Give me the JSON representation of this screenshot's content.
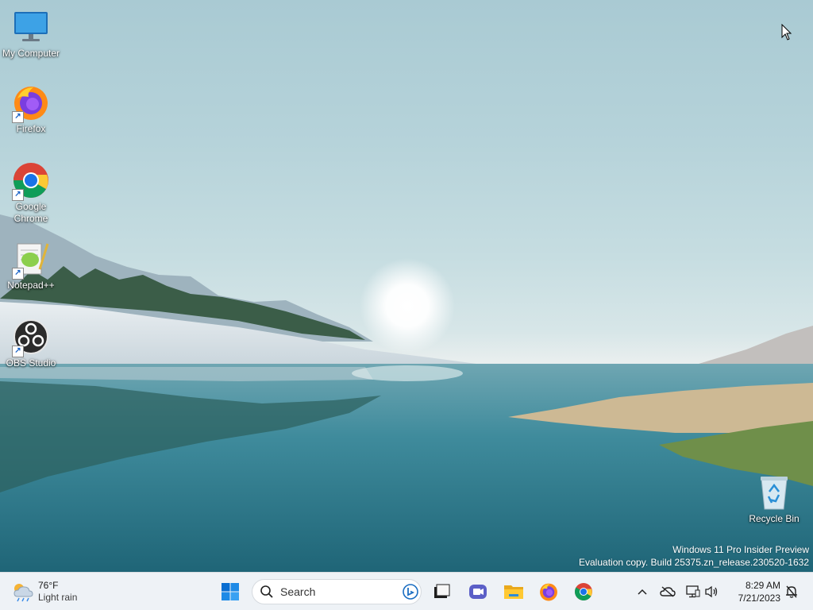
{
  "desktop": {
    "icons": [
      {
        "label": "My Computer",
        "icon": "monitor-icon",
        "shortcut": false
      },
      {
        "label": "Firefox",
        "icon": "firefox-icon",
        "shortcut": true
      },
      {
        "label": "Google Chrome",
        "icon": "chrome-icon",
        "shortcut": true
      },
      {
        "label": "Notepad++",
        "icon": "notepadpp-icon",
        "shortcut": true
      },
      {
        "label": "OBS Studio",
        "icon": "obs-icon",
        "shortcut": true
      },
      {
        "label": "Recycle Bin",
        "icon": "recycle-bin-icon",
        "shortcut": false
      }
    ],
    "shortcut_glyph": "↗",
    "watermark": {
      "line1": "Windows 11 Pro Insider Preview",
      "line2": "Evaluation copy. Build 25375.zn_release.230520-1632"
    }
  },
  "taskbar": {
    "weather": {
      "temperature": "76°F",
      "condition": "Light rain",
      "icon": "cloud-rain-icon"
    },
    "search_placeholder": "Search",
    "pinned": [
      {
        "name": "start-button",
        "icon": "windows-logo-icon"
      },
      {
        "name": "task-view-button",
        "icon": "task-view-icon"
      },
      {
        "name": "teams-chat-button",
        "icon": "teams-icon"
      },
      {
        "name": "file-explorer-button",
        "icon": "folder-icon"
      },
      {
        "name": "firefox-taskbar-button",
        "icon": "firefox-icon"
      },
      {
        "name": "chrome-taskbar-button",
        "icon": "chrome-icon"
      }
    ],
    "tray": {
      "icons": [
        "chevron-up-icon",
        "onedrive-icon",
        "network-icon",
        "volume-icon",
        "notification-icon"
      ],
      "time": "8:29 AM",
      "date": "7/21/2023"
    }
  },
  "colors": {
    "taskbar_bg": "#eef2f6",
    "accent": "#0078d4"
  }
}
